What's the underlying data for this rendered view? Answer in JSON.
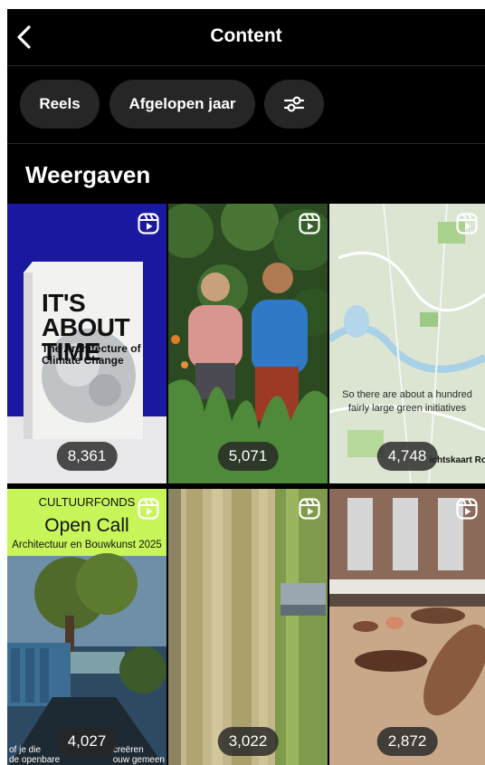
{
  "header": {
    "title": "Content",
    "back_icon": "chevron-left-icon"
  },
  "filters": {
    "reels": "Reels",
    "period": "Afgelopen jaar",
    "settings_icon": "sliders-icon"
  },
  "section": {
    "title": "Weergaven"
  },
  "tiles": [
    {
      "views": "8,361",
      "book_title": "IT'S ABOUT TIME",
      "book_subtitle": "The Architecture of Climate Change"
    },
    {
      "views": "5,071"
    },
    {
      "views": "4,748",
      "caption": "So there are about a hundred fairly large green initiatives",
      "map_label": "ichtskaart Ro"
    },
    {
      "views": "4,027",
      "badge": "CULTUURFONDS",
      "headline": "Open Call",
      "subheadline": "Architectuur en Bouwkunst 2025",
      "foot_left": "of je die\nde openbare",
      "foot_right": "creëren\nouw gemeen"
    },
    {
      "views": "3,022"
    },
    {
      "views": "2,872"
    }
  ],
  "colors": {
    "background": "#000000",
    "chip": "#262626",
    "accent_green": "#c8f65a"
  }
}
